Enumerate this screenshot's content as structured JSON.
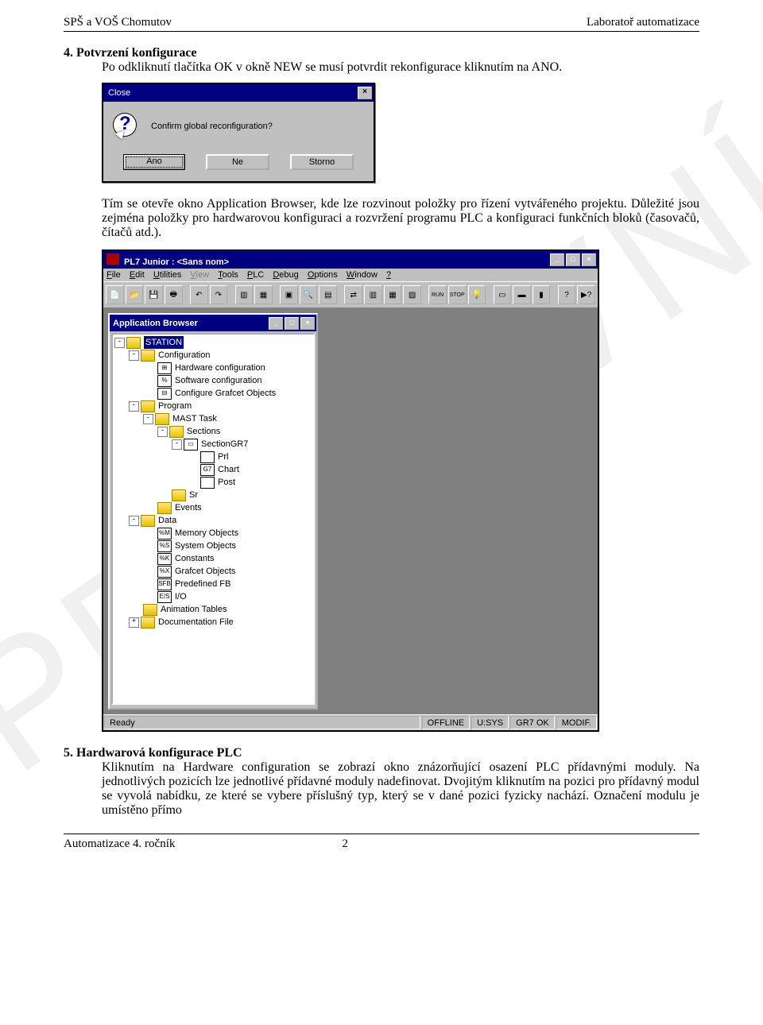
{
  "header": {
    "left": "SPŠ a VOŠ Chomutov",
    "right": "Laboratoř automatizace"
  },
  "watermark": "PRACOVNÍ",
  "sec4": {
    "title": "4. Potvrzení konfigurace",
    "p1": "Po odkliknutí tlačítka OK v okně NEW se musí potvrdit rekonfigurace kliknutím na ANO.",
    "p2": "Tím se otevře okno Application Browser, kde lze rozvinout položky pro řízení vytvářeného projektu. Důležité jsou zejména položky pro hardwarovou konfiguraci a rozvržení programu PLC a konfiguraci funkčních bloků (časovačů, čítačů atd.)."
  },
  "dialog1": {
    "title": "Close",
    "message": "Confirm global reconfiguration?",
    "buttons": {
      "yes": "Ano",
      "no": "Ne",
      "cancel": "Storno"
    }
  },
  "pl7": {
    "title": "PL7 Junior : <Sans nom>",
    "menu": [
      "File",
      "Edit",
      "Utilities",
      "View",
      "Tools",
      "PLC",
      "Debug",
      "Options",
      "Window",
      "?"
    ],
    "appbrowser_title": "Application Browser",
    "tree": {
      "root": "STATION",
      "configuration": {
        "label": "Configuration",
        "items": [
          "Hardware configuration",
          "Software configuration",
          "Configure Grafcet Objects"
        ]
      },
      "program": {
        "label": "Program",
        "mast": {
          "label": "MAST Task",
          "sections": {
            "label": "Sections",
            "sectiongr7": {
              "label": "SectionGR7",
              "items": [
                "Prl",
                "Chart",
                "Post"
              ]
            }
          },
          "sr": "Sr",
          "events": "Events"
        }
      },
      "data": {
        "label": "Data",
        "items": [
          {
            "code": "%M",
            "label": "Memory Objects"
          },
          {
            "code": "%S",
            "label": "System Objects"
          },
          {
            "code": "%K",
            "label": "Constants"
          },
          {
            "code": "%X",
            "label": "Grafcet Objects"
          },
          {
            "code": "SFB",
            "label": "Predefined FB"
          },
          {
            "code": "E/S",
            "label": "I/O"
          }
        ]
      },
      "animation": "Animation Tables",
      "documentation": "Documentation File"
    },
    "status": {
      "ready": "Ready",
      "offline": "OFFLINE",
      "usys": "U:SYS",
      "gr7": "GR7 OK",
      "modif": "MODIF."
    }
  },
  "sec5": {
    "title": "5. Hardwarová konfigurace PLC",
    "p1": "Kliknutím na Hardware configuration se zobrazí okno znázorňující osazení PLC přídavnými moduly. Na jednotlivých pozicích lze jednotlivé přídavné moduly nadefinovat. Dvojitým kliknutím na pozici pro přídavný modul se vyvolá nabídku, ze které se vybere příslušný typ, který se v dané pozici fyzicky nachází. Označení modulu je umístěno přímo"
  },
  "footer": {
    "left": "Automatizace 4. ročník",
    "page": "2"
  }
}
